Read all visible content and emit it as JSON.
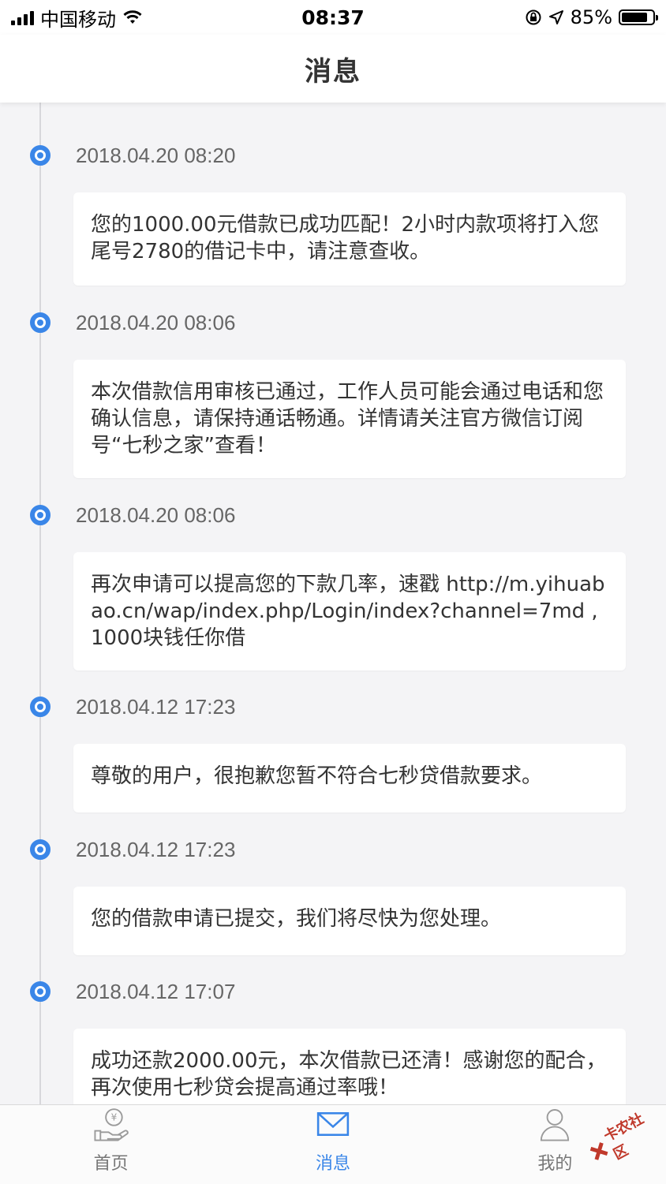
{
  "status_bar": {
    "carrier": "中国移动",
    "time": "08:37",
    "battery": "85%",
    "battery_level": 0.85
  },
  "nav": {
    "title": "消息"
  },
  "messages": [
    {
      "time": "2018.04.20 08:20",
      "text": "您的1000.00元借款已成功匹配！2小时内款项将打入您尾号2780的借记卡中，请注意查收。"
    },
    {
      "time": "2018.04.20 08:06",
      "text": "本次借款信用审核已通过，工作人员可能会通过电话和您确认信息，请保持通话畅通。详情请关注官方微信订阅号“七秒之家”查看！"
    },
    {
      "time": "2018.04.20 08:06",
      "text": "再次申请可以提高您的下款几率，速戳 http://m.yihuabao.cn/wap/index.php/Login/index?channel=7md ,1000块钱任你借"
    },
    {
      "time": "2018.04.12 17:23",
      "text": "尊敬的用户，很抱歉您暂不符合七秒贷借款要求。"
    },
    {
      "time": "2018.04.12 17:23",
      "text": "您的借款申请已提交，我们将尽快为您处理。"
    },
    {
      "time": "2018.04.12 17:07",
      "text": "成功还款2000.00元，本次借款已还清！感谢您的配合，再次使用七秒贷会提高通过率哦！"
    }
  ],
  "tabs": [
    {
      "label": "首页",
      "icon": "yen-hand-icon",
      "active": false
    },
    {
      "label": "消息",
      "icon": "mail-icon",
      "active": true
    },
    {
      "label": "我的",
      "icon": "user-icon",
      "active": false
    }
  ],
  "watermark": {
    "text": "卡农社区"
  },
  "colors": {
    "accent": "#3a86e8",
    "background": "#f4f4f6",
    "card": "#ffffff"
  }
}
